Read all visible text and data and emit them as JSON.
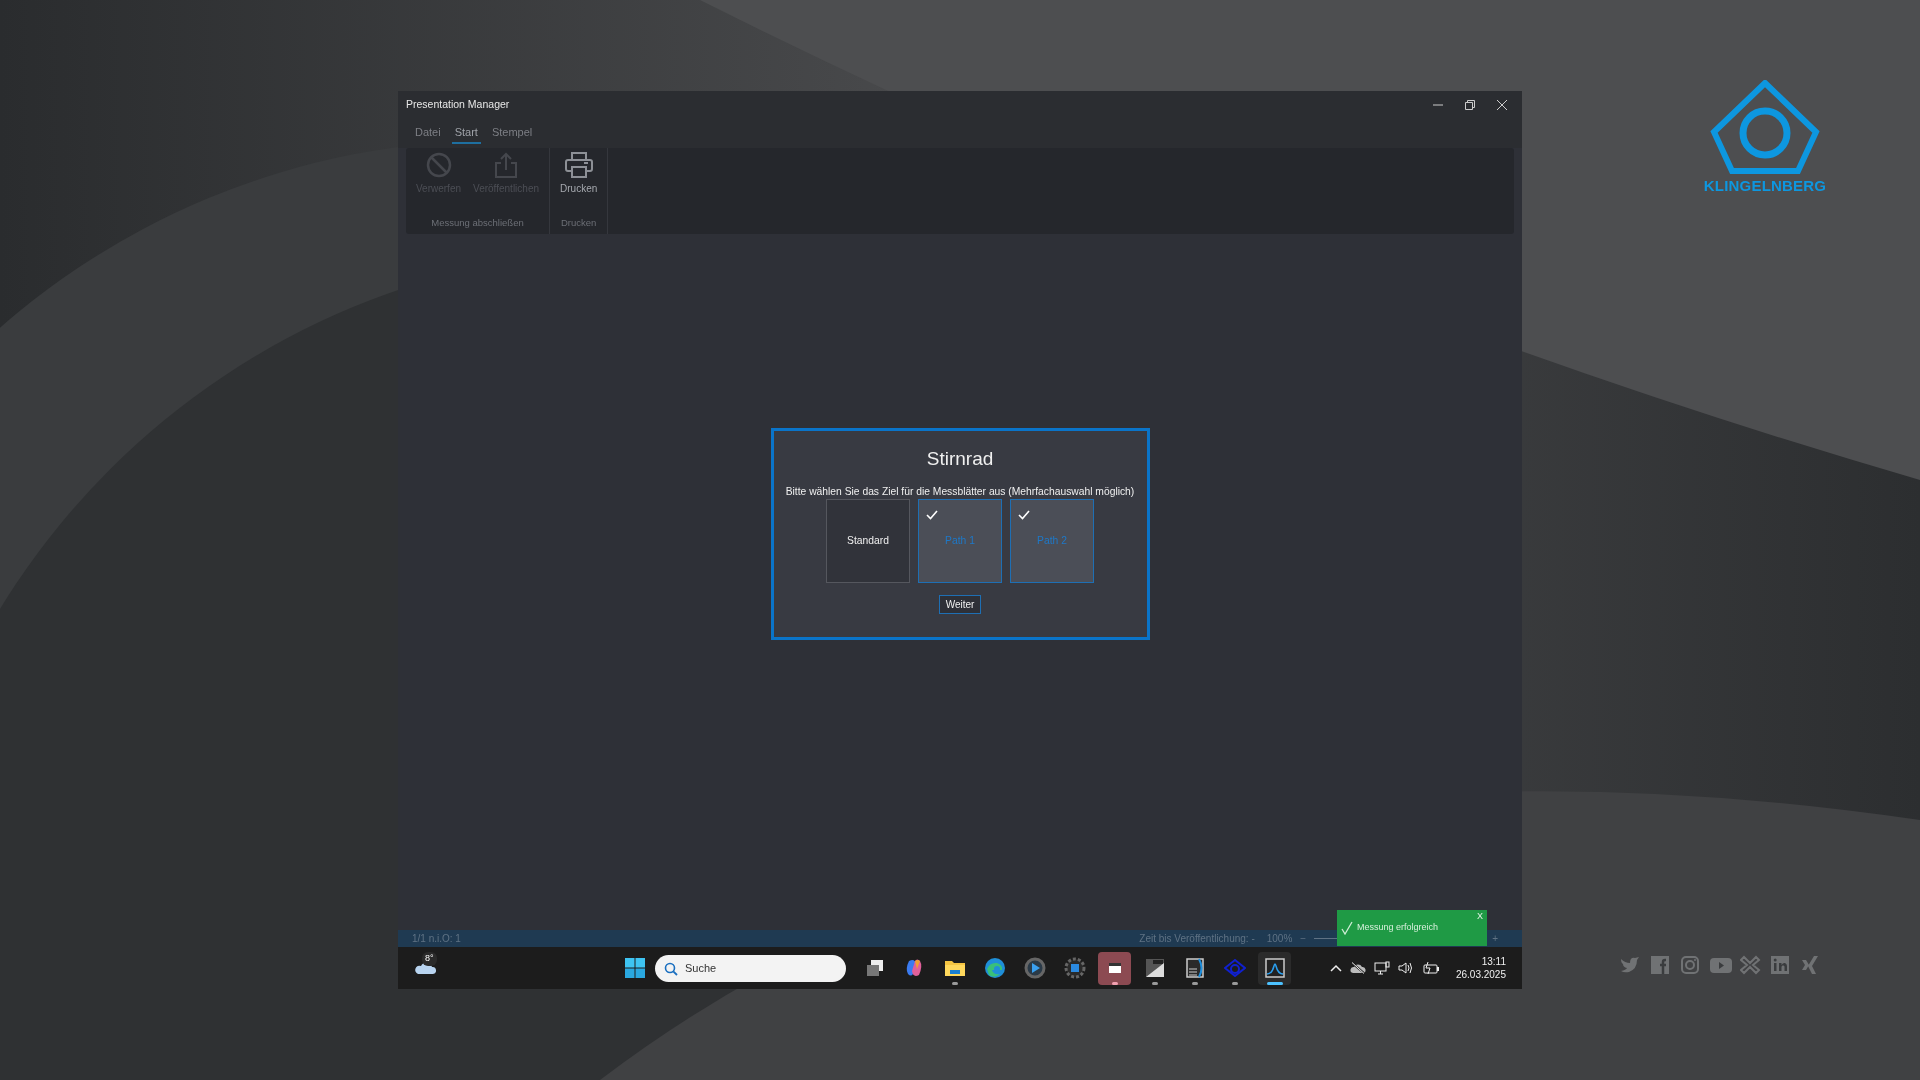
{
  "window": {
    "title": "Presentation Manager"
  },
  "menu_tabs": [
    {
      "label": "Datei",
      "selected": false
    },
    {
      "label": "Start",
      "selected": true
    },
    {
      "label": "Stempel",
      "selected": false
    }
  ],
  "ribbon_groups": [
    {
      "label": "Messung abschließen",
      "buttons": [
        {
          "label": "Verwerfen",
          "kind": "cancel",
          "disabled": true
        },
        {
          "label": "Veröffentlichen",
          "kind": "share",
          "disabled": true
        }
      ]
    },
    {
      "label": "Drucken",
      "buttons": [
        {
          "label": "Drucken",
          "kind": "print",
          "disabled": false
        }
      ]
    }
  ],
  "dialog": {
    "title": "Stirnrad",
    "prompt": "Bitte wählen Sie das Ziel für die Messblätter aus (Mehrfachauswahl möglich)",
    "options": [
      {
        "label": "Standard",
        "selected": false
      },
      {
        "label": "Path 1",
        "selected": true
      },
      {
        "label": "Path 2",
        "selected": true
      }
    ],
    "button": "Weiter"
  },
  "status_bar": {
    "count": "1/1 n.i.O: 1",
    "publish_time": "Zeit bis Veröffentlichung: -",
    "zoom": "100%",
    "zoom_out": "−",
    "zoom_in": "+"
  },
  "toast": {
    "message": "Messung erfolgreich",
    "close": "X"
  },
  "taskbar": {
    "weather": "8°",
    "search": {
      "placeholder": "Suche"
    },
    "apps": [
      {
        "kind": "taskview",
        "running": false,
        "selected": false,
        "flashing": false
      },
      {
        "kind": "copilot",
        "running": false,
        "selected": false,
        "flashing": false
      },
      {
        "kind": "folder",
        "running": true,
        "selected": false,
        "flashing": false
      },
      {
        "kind": "edge",
        "running": false,
        "selected": false,
        "flashing": false
      },
      {
        "kind": "player",
        "running": false,
        "selected": false,
        "flashing": false
      },
      {
        "kind": "gearsquare",
        "running": false,
        "selected": false,
        "flashing": false
      },
      {
        "kind": "redapp",
        "running": true,
        "selected": false,
        "flashing": true
      },
      {
        "kind": "htb",
        "running": true,
        "selected": false,
        "flashing": false
      },
      {
        "kind": "disk",
        "running": true,
        "selected": false,
        "flashing": false
      },
      {
        "kind": "eye",
        "running": true,
        "selected": false,
        "flashing": false
      },
      {
        "kind": "chart",
        "running": true,
        "selected": true,
        "flashing": false
      }
    ],
    "time": "13:11",
    "date": "26.03.2025"
  },
  "brand": {
    "name": "KLINGELNBERG"
  }
}
